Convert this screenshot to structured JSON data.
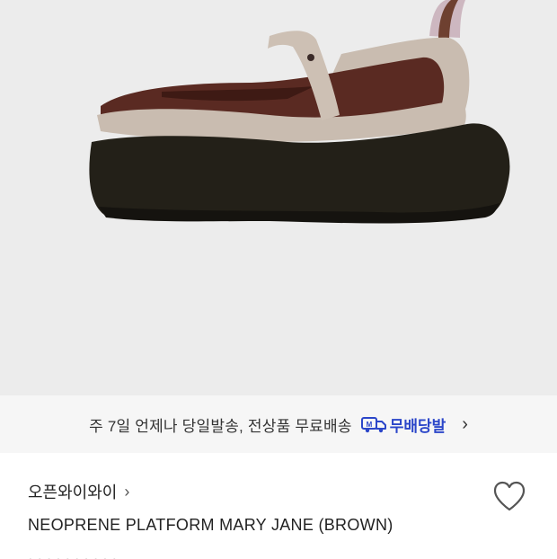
{
  "product_image": {
    "alt": "brown neoprene platform mary jane shoe"
  },
  "shipping_banner": {
    "text": "주 7일 언제나 당일발송, 전상품 무료배송",
    "badge_label": "무배당발",
    "badge_icon": "truck-icon",
    "accent_color": "#2b46c9"
  },
  "product": {
    "brand": "오픈와이와이",
    "name": "NEOPRENE PLATFORM MARY JANE (BROWN)",
    "partial_line": "· · · · · · · · · ·"
  },
  "icons": {
    "favorite": "heart-icon",
    "brand_link": "chevron-right-icon"
  }
}
